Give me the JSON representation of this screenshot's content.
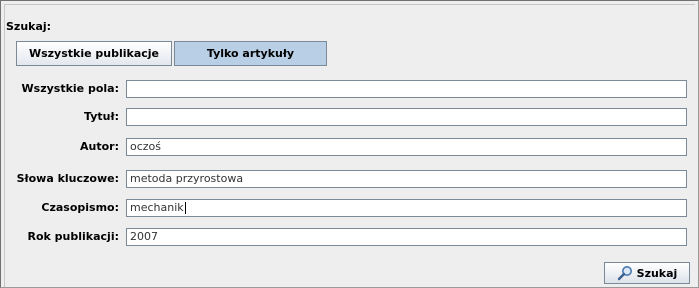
{
  "search": {
    "heading": "Szukaj:",
    "tabs": [
      {
        "label": "Wszystkie publikacje",
        "selected": false
      },
      {
        "label": "Tylko artykuły",
        "selected": true
      }
    ],
    "fields": [
      {
        "label": "Wszystkie pola:",
        "value": ""
      },
      {
        "label": "Tytuł:",
        "value": ""
      },
      {
        "label": "Autor:",
        "value": "oczoś"
      },
      {
        "label": "Słowa kluczowe:",
        "value": "metoda przyrostowa"
      },
      {
        "label": "Czasopismo:",
        "value": "mechanik"
      },
      {
        "label": "Rok publikacji:",
        "value": "2007"
      }
    ],
    "button_label": "Szukaj",
    "button_icon": "magnifier-icon"
  }
}
